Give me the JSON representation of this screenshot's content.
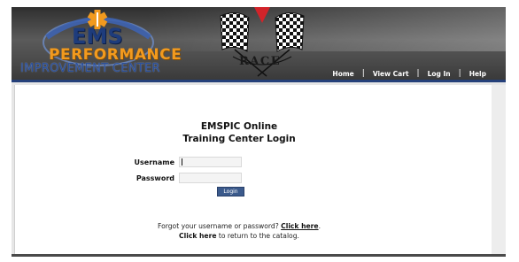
{
  "header": {
    "logo": {
      "line1": "EMS",
      "line2": "PERFORMANCE",
      "line3": "IMPROVEMENT CENTER"
    },
    "race_badge": "RACE",
    "nav": [
      {
        "label": "Home"
      },
      {
        "label": "View Cart"
      },
      {
        "label": "Log In"
      },
      {
        "label": "Help"
      }
    ],
    "colors": {
      "header_bg": "#4a4a4a",
      "accent_blue": "#25407a",
      "logo_orange": "#f29a1e"
    }
  },
  "login": {
    "title_line1": "EMSPIC Online",
    "title_line2": "Training Center Login",
    "username_label": "Username",
    "username_value": "",
    "password_label": "Password",
    "password_value": "",
    "submit_label": "Login"
  },
  "footer": {
    "forgot_text": "Forgot your username or password? ",
    "forgot_link": "Click here",
    "forgot_end": ".",
    "return_link": "Click here",
    "return_text": " to return to the catalog."
  }
}
